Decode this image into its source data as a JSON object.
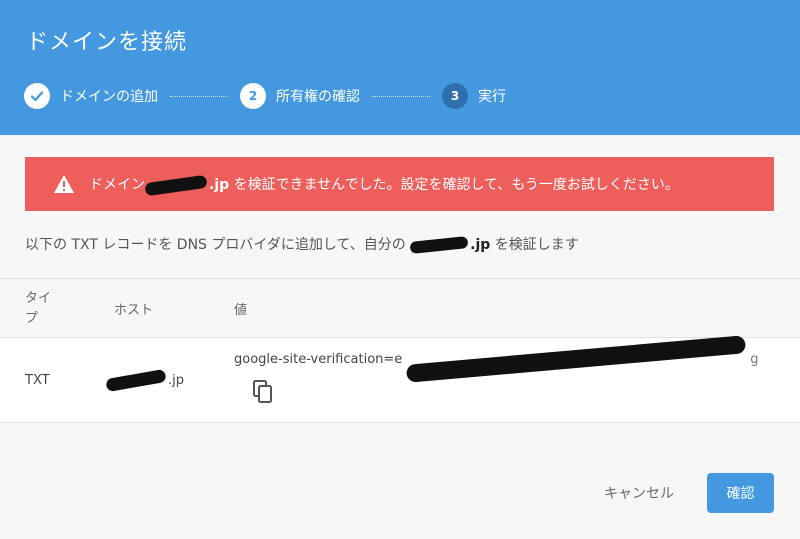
{
  "dialog": {
    "title": "ドメインを接続"
  },
  "steps": [
    {
      "number": "",
      "label": "ドメインの追加",
      "state": "done"
    },
    {
      "number": "2",
      "label": "所有権の確認",
      "state": "current"
    },
    {
      "number": "3",
      "label": "実行",
      "state": "pending"
    }
  ],
  "alert": {
    "prefix": "ドメイン",
    "domain_suffix": ".jp",
    "message": " を検証できませんでした。設定を確認して、もう一度お試しください。"
  },
  "description": {
    "prefix": "以下の TXT レコードを DNS プロバイダに追加して、自分の ",
    "domain_suffix": ".jp",
    "suffix": " を検証します"
  },
  "table": {
    "headers": {
      "type": "タイプ",
      "host": "ホスト",
      "value": "値"
    },
    "row": {
      "type": "TXT",
      "host_suffix": ".jp",
      "value_prefix": "google-site-verification=e",
      "value_tail": "g"
    }
  },
  "buttons": {
    "cancel": "キャンセル",
    "confirm": "確認"
  },
  "colors": {
    "header": "#4398e0",
    "alert": "#ee5f5b",
    "primary": "#4398e0"
  }
}
